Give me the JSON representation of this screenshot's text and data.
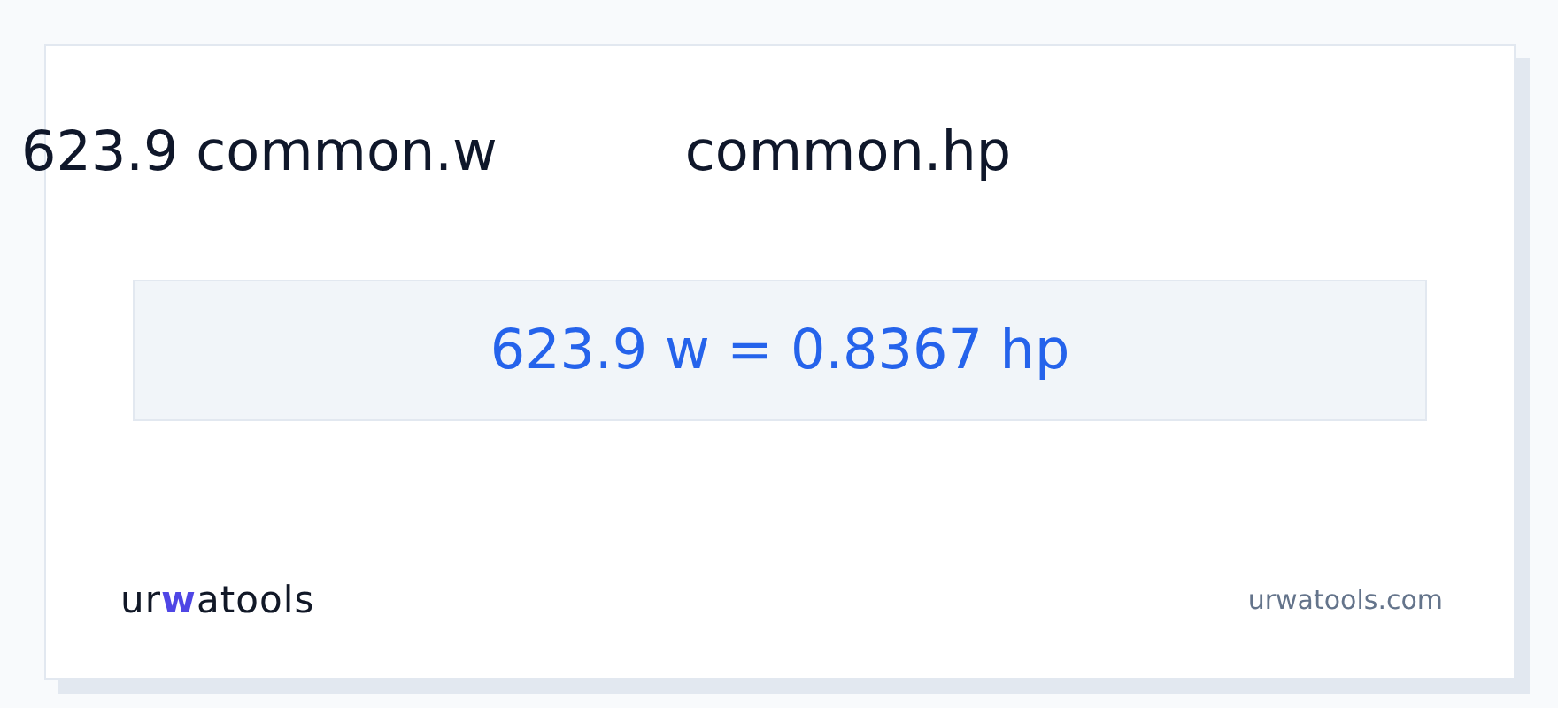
{
  "heading": {
    "from": "623.9 common.w",
    "to": "common.hp"
  },
  "result": "623.9 w = 0.8367 hp",
  "logo": {
    "parts": [
      {
        "text": "ur",
        "accent": false
      },
      {
        "text": "w",
        "accent": true
      },
      {
        "text": "atools",
        "accent": false
      }
    ]
  },
  "site": "urwatools.com"
}
